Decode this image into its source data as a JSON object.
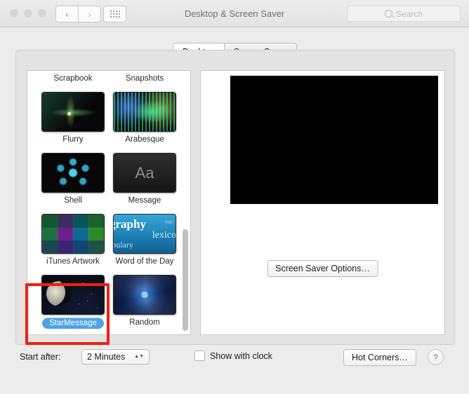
{
  "window": {
    "title": "Desktop & Screen Saver",
    "traffic_lights": [
      "close",
      "minimize",
      "zoom"
    ],
    "nav": {
      "back": "‹",
      "forward": "›"
    },
    "grid_button": "all-preferences"
  },
  "search": {
    "placeholder": "Search"
  },
  "tabs": [
    {
      "label": "Desktop",
      "selected": true
    },
    {
      "label": "Screen Saver",
      "selected": false
    }
  ],
  "screensaver_list": {
    "items": [
      {
        "label": "Scrapbook",
        "art": "monitor",
        "selected": false
      },
      {
        "label": "Snapshots",
        "art": "monitor",
        "selected": false
      },
      {
        "label": "Flurry",
        "art": "flurry",
        "selected": false
      },
      {
        "label": "Arabesque",
        "art": "arabesque",
        "selected": false
      },
      {
        "label": "Shell",
        "art": "shell",
        "selected": false
      },
      {
        "label": "Message",
        "art": "message",
        "selected": false
      },
      {
        "label": "iTunes Artwork",
        "art": "itunes",
        "selected": false
      },
      {
        "label": "Word of the Day",
        "art": "wotd",
        "selected": false
      },
      {
        "label": "StarMessage",
        "art": "star",
        "selected": true
      },
      {
        "label": "Random",
        "art": "random",
        "selected": false
      }
    ],
    "message_thumb_text": "Aa",
    "wotd_thumb_words": [
      "graphy",
      "lexicog",
      "abulary",
      "voc"
    ],
    "selected_label": "StarMessage"
  },
  "preview": {
    "state": "black"
  },
  "options_button": {
    "label": "Screen Saver Options…"
  },
  "bottom_bar": {
    "start_after_label": "Start after:",
    "start_after_value": "2 Minutes",
    "show_with_clock_label": "Show with clock",
    "show_with_clock_checked": false,
    "hot_corners_label": "Hot Corners…",
    "help_label": "?"
  },
  "annotation": {
    "color": "#f41f10",
    "target": "StarMessage"
  }
}
